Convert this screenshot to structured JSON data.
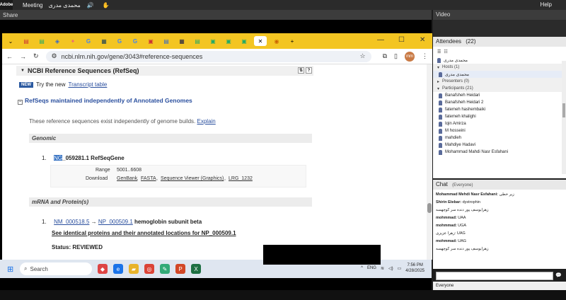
{
  "topbar": {
    "logo": "Adobe",
    "meeting": "Meeting",
    "user": "محمدی مدری",
    "help": "Help"
  },
  "share": {
    "title": "Share"
  },
  "browser": {
    "url": "ncbi.nlm.nih.gov/gene/3043#reference-sequences",
    "avatar": "mm"
  },
  "page": {
    "section_title": "NCBI Reference Sequences (RefSeq)",
    "new_badge": "NEW",
    "try_text": "Try the new",
    "try_link": "Transcript table",
    "maintained": "RefSeqs maintained independently of Annotated Genomes",
    "exist_text": "These reference sequences exist independently of genome builds.",
    "explain": "Explain",
    "genomic_label": "Genomic",
    "genomic_item_num": "1.",
    "genomic_ng_hl": "NG",
    "genomic_ng_rest": "_059281.1 RefSeqGene",
    "range_label": "Range",
    "range_value": "5001..6608",
    "download_label": "Download",
    "download_links": [
      "GenBank",
      "FASTA",
      "Sequence Viewer (Graphics)",
      "LRG_1232"
    ],
    "mrna_label": "mRNA and Protein(s)",
    "mrna_item_num": "1.",
    "mrna_nm": "NM_000518.5",
    "mrna_arrow": "→",
    "mrna_np": "NP_000509.1",
    "mrna_desc": "hemoglobin subunit beta",
    "identical_link": "See identical proteins and their annotated locations for NP_000509.1",
    "status": "Status: REVIEWED"
  },
  "taskbar": {
    "search_placeholder": "Search",
    "lang": "ENG",
    "time": "7:56 PM",
    "date": "4/28/2025"
  },
  "video": {
    "title": "Video"
  },
  "attendees": {
    "title": "Attendees",
    "count": "(22)",
    "self_name": "محمدی مدری",
    "hosts_label": "Hosts (1)",
    "host_name": "محمدی مدری",
    "presenters_label": "Presenters (0)",
    "participants_label": "Participants (21)",
    "participants": [
      "Banafsheh Heidari",
      "Banafsheh Heidari 2",
      "fatemeh hashembaiki",
      "fatemeh khalighi",
      "Iqin Amirza",
      "M hosseini",
      "mahdieh",
      "Mahdiye Hadavi",
      "Mohammad Mahdi Nasr Esfahani"
    ]
  },
  "chat": {
    "title": "Chat",
    "audience": "(Everyone)",
    "lines": [
      {
        "name": "Mohammad Mehdi Nasr Esfahani:",
        "msg": "زیر خطی"
      },
      {
        "name": "Shirin Etebar:",
        "msg": "dystrophin"
      },
      {
        "name": "",
        "msg": "زهرایوسف پور دنده سر کوچهسه"
      },
      {
        "name": "mohmmad:",
        "msg": "UAA"
      },
      {
        "name": "mohmmad:",
        "msg": "UGA"
      },
      {
        "name": "",
        "msg": "زهرا عزیزی: UAG"
      },
      {
        "name": "mohmmad:",
        "msg": "UAG"
      },
      {
        "name": "",
        "msg": "زهرایوسف پور دنده سر کوچهسه"
      }
    ],
    "footer": "Everyone"
  }
}
